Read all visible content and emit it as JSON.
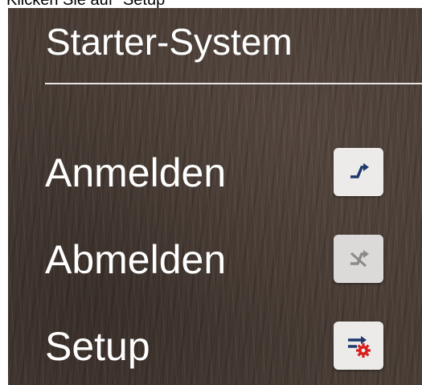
{
  "caption": "Klicken Sie auf \"Setup\"",
  "panel": {
    "title": "Starter-System",
    "items": [
      {
        "label": "Anmelden",
        "icon": "login-arrow-icon",
        "enabled": true
      },
      {
        "label": "Abmelden",
        "icon": "logout-arrow-icon",
        "enabled": false
      },
      {
        "label": "Setup",
        "icon": "setup-gear-icon",
        "enabled": true
      }
    ]
  },
  "colors": {
    "icon_blue": "#1d3a6b",
    "icon_gray": "#8a8a8a",
    "gear_red": "#d81e1e",
    "text_white": "#ffffff"
  }
}
